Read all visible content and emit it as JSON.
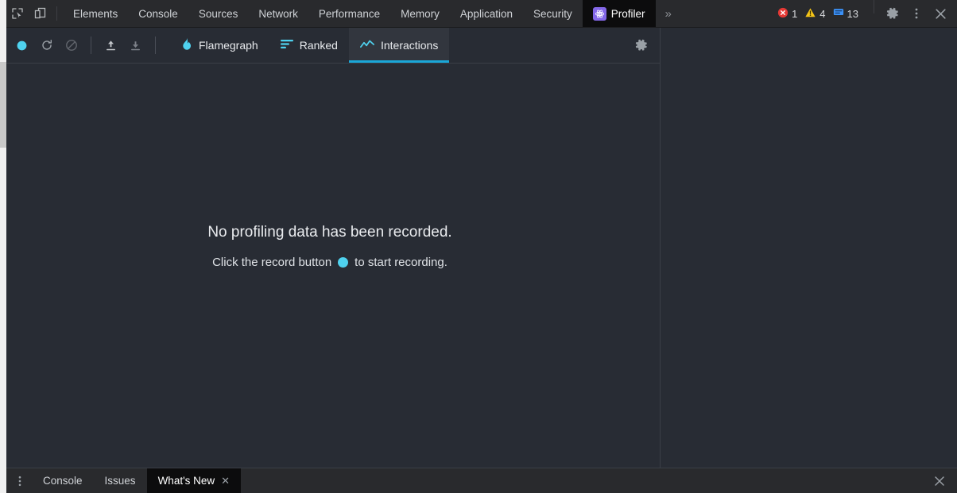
{
  "topbar": {
    "tools": [
      {
        "name": "inspect-element-icon",
        "label": "Inspect element"
      },
      {
        "name": "device-toolbar-icon",
        "label": "Toggle device toolbar"
      }
    ],
    "tabs": [
      {
        "label": "Elements",
        "selected": false
      },
      {
        "label": "Console",
        "selected": false
      },
      {
        "label": "Sources",
        "selected": false
      },
      {
        "label": "Network",
        "selected": false
      },
      {
        "label": "Performance",
        "selected": false
      },
      {
        "label": "Memory",
        "selected": false
      },
      {
        "label": "Application",
        "selected": false
      },
      {
        "label": "Security",
        "selected": false
      },
      {
        "label": "Profiler",
        "selected": true,
        "icon": "react-logo-icon"
      }
    ],
    "more_tabs_label": "»",
    "counters": {
      "errors": "1",
      "warnings": "4",
      "messages": "13"
    },
    "actions": [
      {
        "name": "settings-gear-icon",
        "label": "Settings"
      },
      {
        "name": "more-options-icon",
        "label": "Customize and control DevTools"
      },
      {
        "name": "close-devtools-icon",
        "label": "Close DevTools"
      }
    ]
  },
  "profiler": {
    "toolbar": {
      "record_label": "Record",
      "reload_label": "Reload and start profiling",
      "clear_label": "Clear profiling data",
      "upload_label": "Load profile",
      "download_label": "Save profile",
      "settings_label": "Settings"
    },
    "view_tabs": [
      {
        "label": "Flamegraph",
        "icon": "flame-icon",
        "selected": false
      },
      {
        "label": "Ranked",
        "icon": "ranked-bars-icon",
        "selected": false
      },
      {
        "label": "Interactions",
        "icon": "line-chart-icon",
        "selected": true
      }
    ],
    "empty_state": {
      "title": "No profiling data has been recorded.",
      "prefix": "Click the record button",
      "suffix": "to start recording."
    }
  },
  "drawer": {
    "menu_label": "More tools",
    "tabs": [
      {
        "label": "Console",
        "selected": false,
        "closable": false
      },
      {
        "label": "Issues",
        "selected": false,
        "closable": false
      },
      {
        "label": "What's New",
        "selected": true,
        "closable": true,
        "close_glyph": "✕"
      }
    ],
    "close_label": "Close drawer",
    "close_glyph": "✕"
  },
  "colors": {
    "accent_cyan": "#1aa7d8",
    "record_cyan": "#4fd2ef",
    "react_purple": "#8468e8",
    "error_red": "#e53935",
    "warning_yellow": "#f5c518",
    "info_blue": "#3b90f5",
    "panel_bg": "#282c34",
    "chrome_bg": "#292a2d"
  }
}
